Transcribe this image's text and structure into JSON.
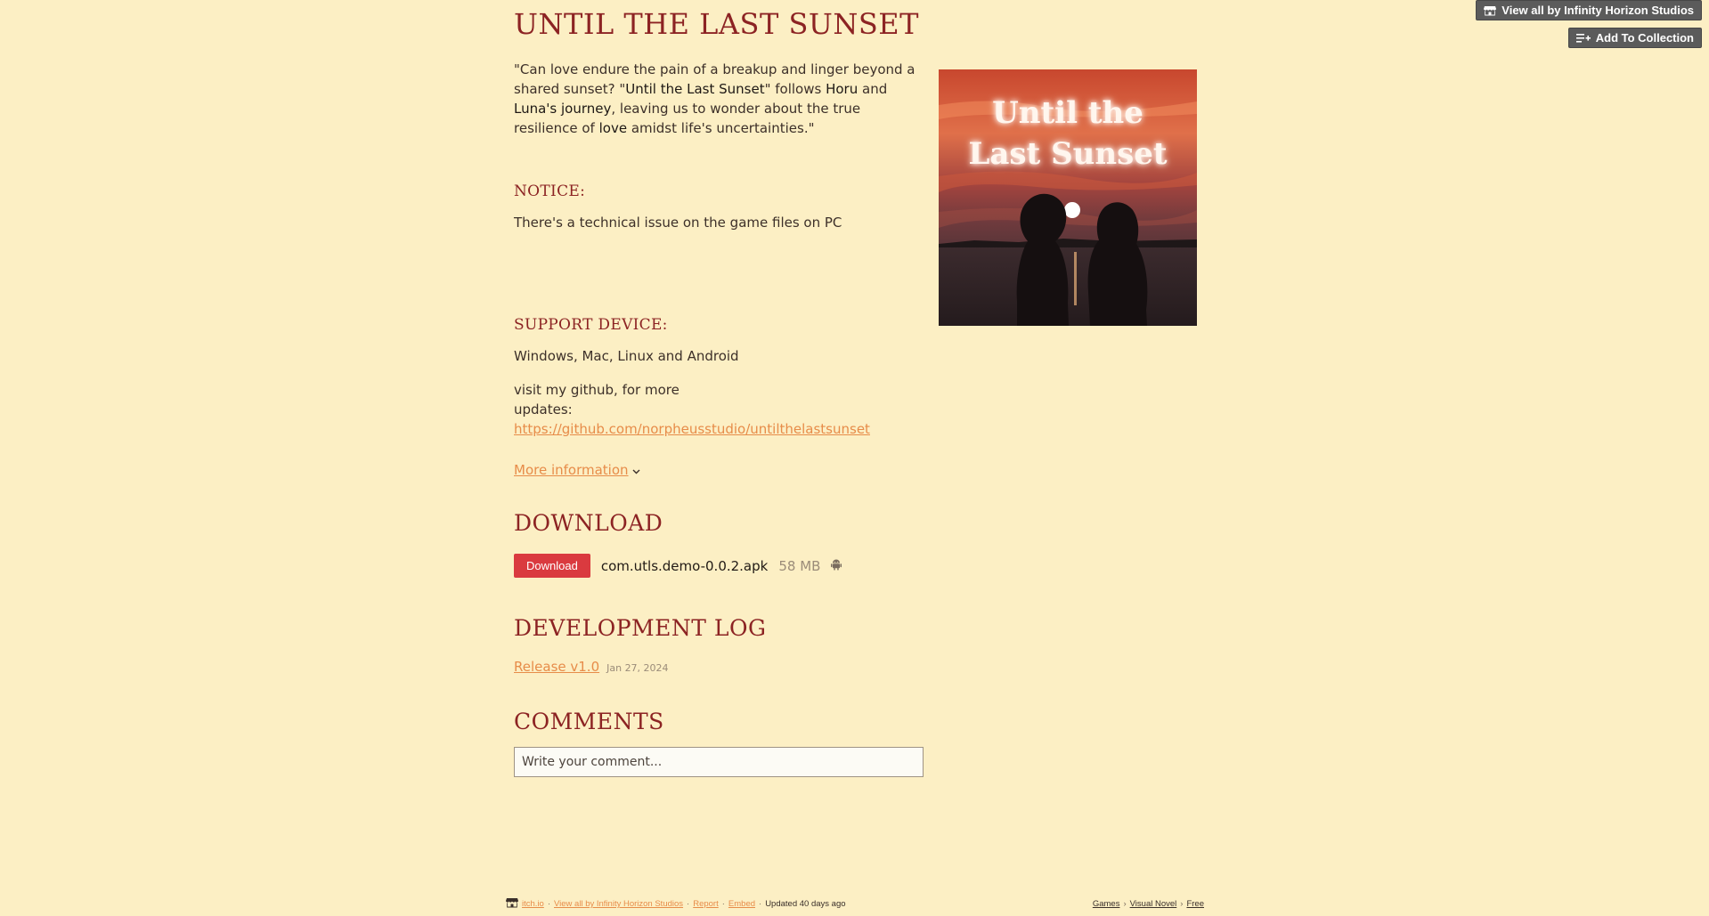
{
  "top_actions": {
    "view_all_label": "View all by Infinity Horizon Studios",
    "add_collection_label": "Add To Collection"
  },
  "game": {
    "title": "UNTIL THE LAST SUNSET",
    "cover_title_line1": "Until the",
    "cover_title_line2": "Last Sunset"
  },
  "intro": {
    "part1": "\"Can love endure the pain of a breakup and linger beyond a shared sunset? \"",
    "title_ref": "Until the Last Sunset",
    "part2": "\" follows ",
    "name1": "Horu",
    "part3": " and ",
    "name2": "Luna's journey",
    "part4": ", leaving us to wonder about the true resilience of ",
    "love": "love",
    "part5": " amidst life's uncertainties.\""
  },
  "notice": {
    "heading": "NOTICE:",
    "text": "There's a technical issue on the game files on PC"
  },
  "support": {
    "heading": "SUPPORT DEVICE:",
    "text": "Windows, Mac, Linux and Android",
    "github_prefix_line1": "visit my github, for more",
    "github_prefix_line2": "updates: ",
    "github_url": "https://github.com/norpheusstudio/untilthelastsunset"
  },
  "more_info": {
    "label": "More information"
  },
  "download": {
    "heading": "DOWNLOAD",
    "button_label": "Download",
    "file_name": "com.utls.demo-0.0.2.apk",
    "file_size": "58 MB",
    "platform_icon": "android-icon"
  },
  "devlog": {
    "heading": "DEVELOPMENT LOG",
    "entry_label": "Release v1.0",
    "entry_date": "Jan 27, 2024"
  },
  "comments": {
    "heading": "COMMENTS",
    "placeholder": "Write your comment..."
  },
  "footer": {
    "itchio": "itch.io",
    "view_all": "View all by Infinity Horizon Studios",
    "report": "Report",
    "embed": "Embed",
    "updated": "Updated 40 days ago",
    "tag_games": "Games",
    "tag_visual_novel": "Visual Novel",
    "tag_free": "Free"
  },
  "colors": {
    "background": "#fcefc4",
    "heading": "#8c2323",
    "link": "#e78c49",
    "download_button": "#da3a3f"
  }
}
